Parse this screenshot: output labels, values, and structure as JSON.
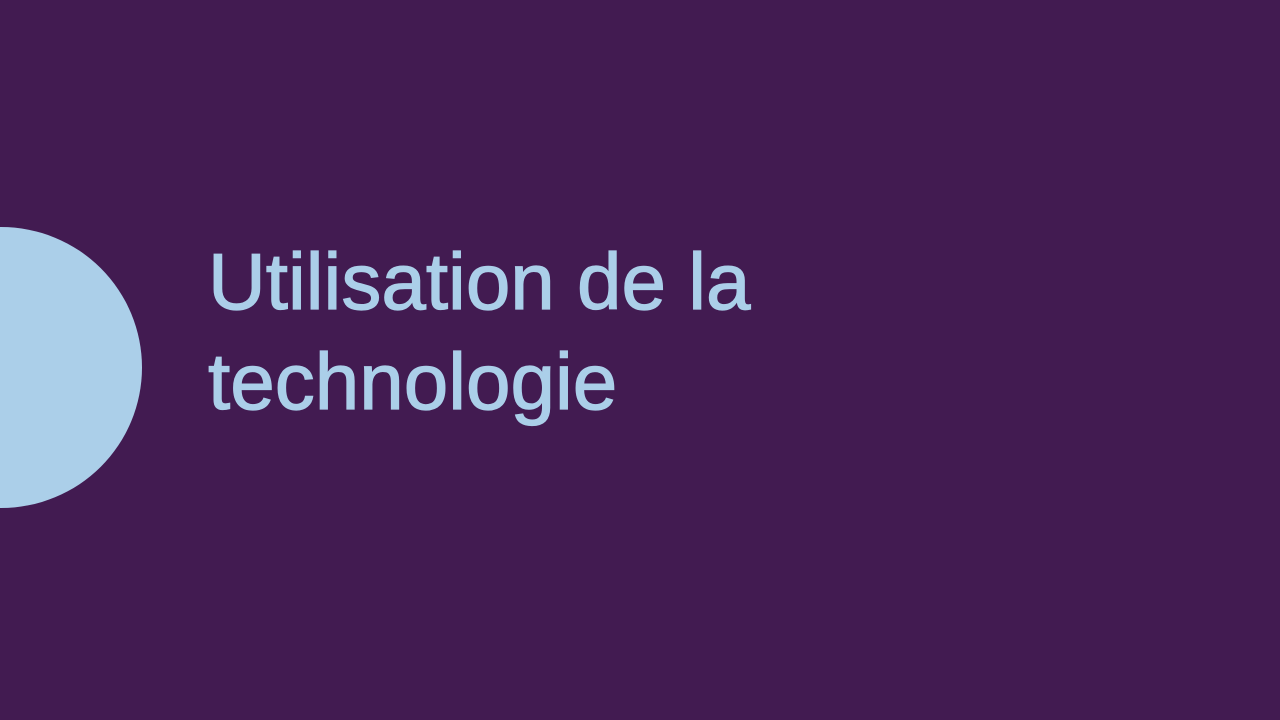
{
  "colors": {
    "background": "#421b51",
    "accent_circle": "#abcfe9",
    "title_text": "#abcfe9"
  },
  "slide": {
    "title_line_1": "Utilisation de la",
    "title_line_2": "technologie"
  }
}
